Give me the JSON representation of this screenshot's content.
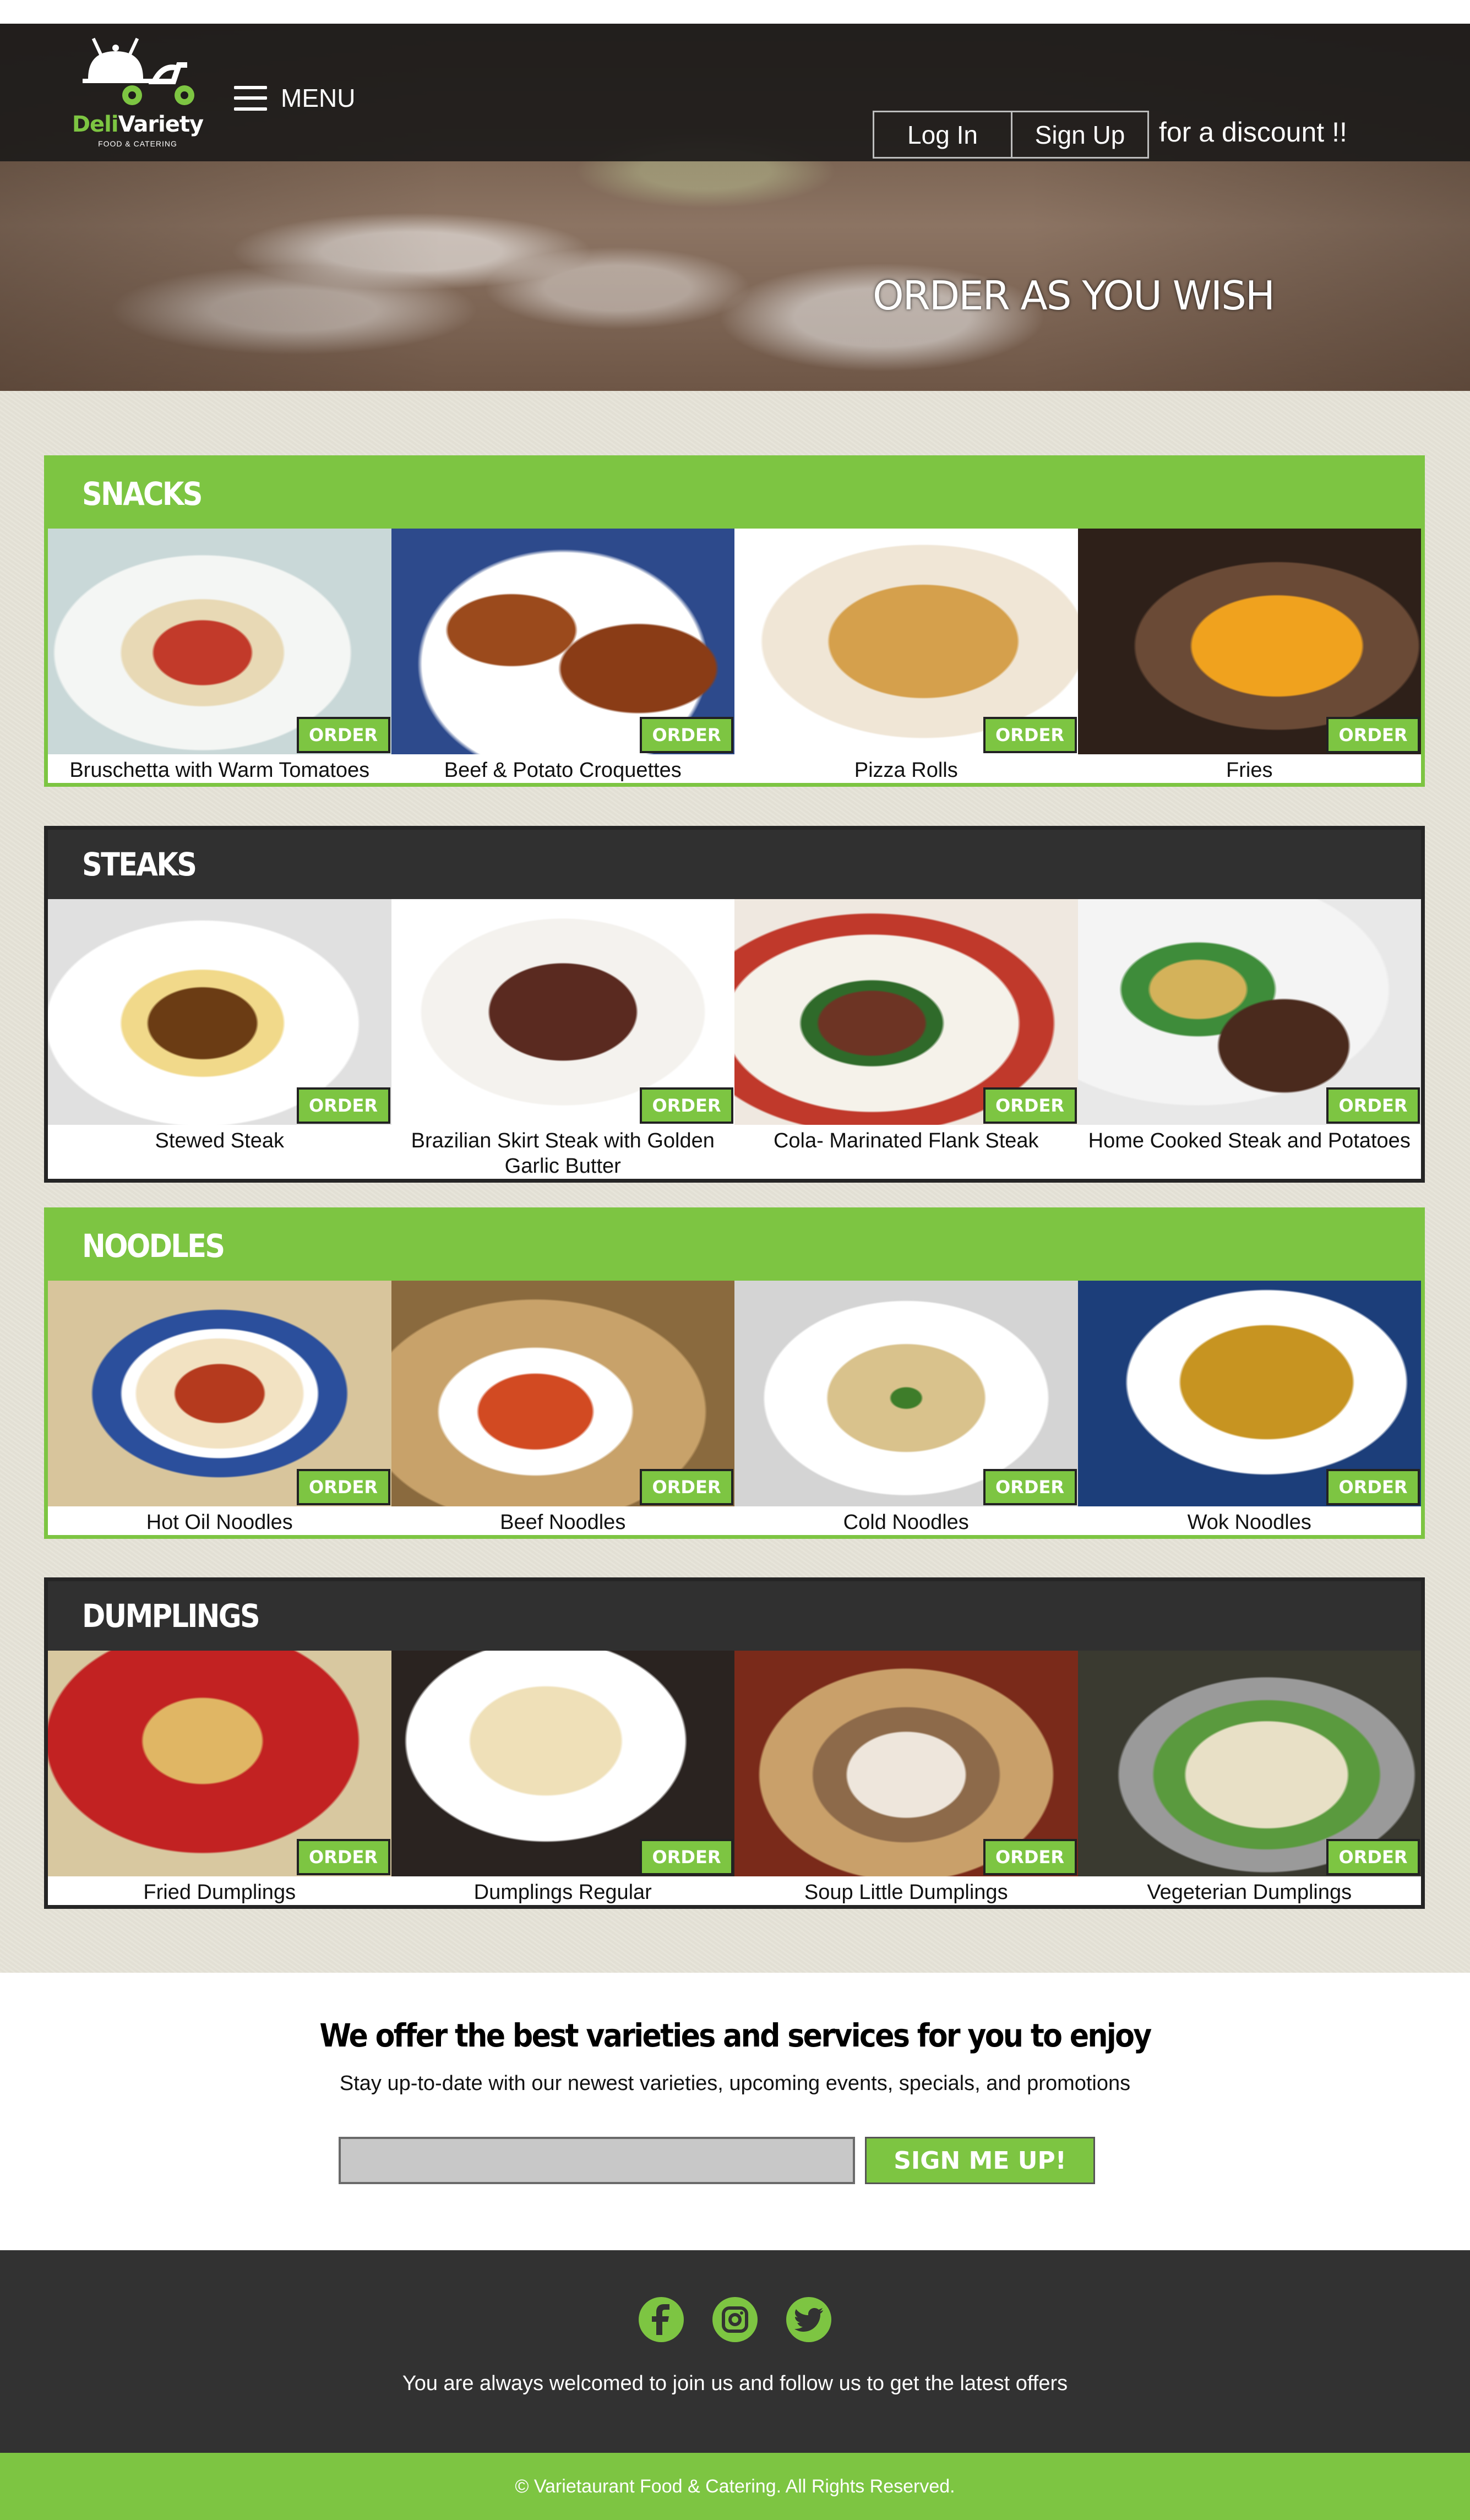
{
  "header": {
    "brand_first": "Deli",
    "brand_second": "Variety",
    "brand_tagline": "FOOD & CATERING",
    "menu_label": "MENU",
    "login_label": "Log In",
    "signup_label": "Sign Up",
    "discount_text": "for a discount !!",
    "hero_title": "ORDER AS YOU WISH"
  },
  "order_label": "ORDER",
  "sections": [
    {
      "title": "SNACKS",
      "theme": "green",
      "items": [
        {
          "name": "Bruschetta with Warm Tomatoes",
          "image": "bruschetta"
        },
        {
          "name": "Beef & Potato Croquettes",
          "image": "croquettes"
        },
        {
          "name": "Pizza Rolls",
          "image": "pizza-rolls"
        },
        {
          "name": "Fries",
          "image": "fries"
        }
      ]
    },
    {
      "title": "STEAKS",
      "theme": "dark",
      "items": [
        {
          "name": "Stewed Steak",
          "image": "stewed-steak"
        },
        {
          "name": "Brazilian Skirt Steak with Golden Garlic Butter",
          "image": "skirt-steak"
        },
        {
          "name": "Cola- Marinated Flank Steak",
          "image": "flank-steak"
        },
        {
          "name": "Home Cooked Steak and Potatoes",
          "image": "steak-potatoes"
        }
      ]
    },
    {
      "title": "NOODLES",
      "theme": "green",
      "items": [
        {
          "name": "Hot Oil Noodles",
          "image": "hot-oil-noodles"
        },
        {
          "name": "Beef Noodles",
          "image": "beef-noodles"
        },
        {
          "name": "Cold Noodles",
          "image": "cold-noodles"
        },
        {
          "name": "Wok Noodles",
          "image": "wok-noodles"
        }
      ]
    },
    {
      "title": "DUMPLINGS",
      "theme": "dark",
      "items": [
        {
          "name": "Fried Dumplings",
          "image": "fried-dumplings"
        },
        {
          "name": "Dumplings Regular",
          "image": "regular-dumplings"
        },
        {
          "name": "Soup Little Dumplings",
          "image": "soup-dumplings"
        },
        {
          "name": "Vegeterian Dumplings",
          "image": "vegetarian-dumplings"
        }
      ]
    }
  ],
  "newsletter": {
    "title": "We offer the best varieties and services for you to enjoy",
    "subtitle": "Stay up-to-date with our newest varieties, upcoming events, specials, and promotions",
    "input_value": "",
    "button_label": "SIGN ME UP!"
  },
  "footer": {
    "socials": [
      "facebook-icon",
      "instagram-icon",
      "twitter-icon"
    ],
    "text": "You are always welcomed to join us and follow us to get the latest offers",
    "copyright": "© Varietaurant Food & Catering. All Rights Reserved."
  },
  "colors": {
    "accent_green": "#7dc542",
    "dark": "#303030",
    "header_bar": "#1e1c1b",
    "page_bg": "#e6e3d8"
  }
}
